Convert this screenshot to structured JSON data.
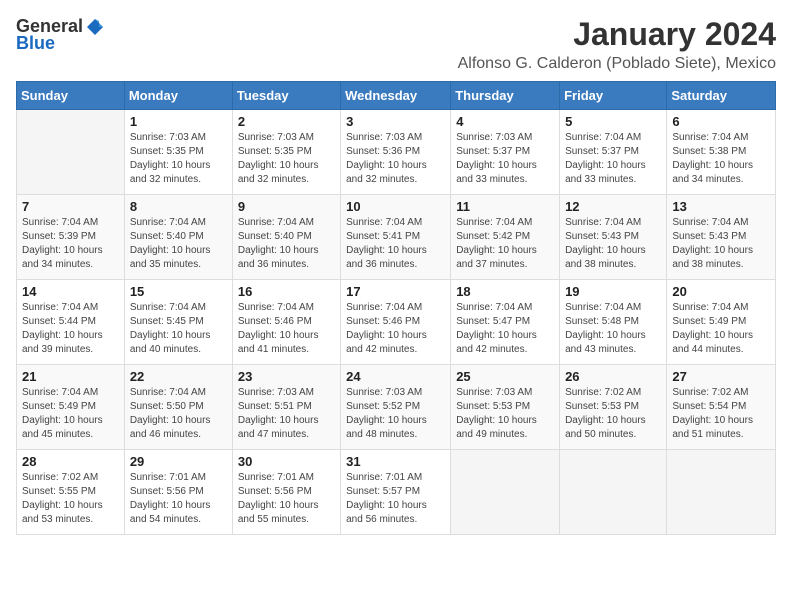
{
  "logo": {
    "general": "General",
    "blue": "Blue"
  },
  "title": "January 2024",
  "subtitle": "Alfonso G. Calderon (Poblado Siete), Mexico",
  "days_of_week": [
    "Sunday",
    "Monday",
    "Tuesday",
    "Wednesday",
    "Thursday",
    "Friday",
    "Saturday"
  ],
  "weeks": [
    [
      {
        "day": "",
        "info": ""
      },
      {
        "day": "1",
        "info": "Sunrise: 7:03 AM\nSunset: 5:35 PM\nDaylight: 10 hours\nand 32 minutes."
      },
      {
        "day": "2",
        "info": "Sunrise: 7:03 AM\nSunset: 5:35 PM\nDaylight: 10 hours\nand 32 minutes."
      },
      {
        "day": "3",
        "info": "Sunrise: 7:03 AM\nSunset: 5:36 PM\nDaylight: 10 hours\nand 32 minutes."
      },
      {
        "day": "4",
        "info": "Sunrise: 7:03 AM\nSunset: 5:37 PM\nDaylight: 10 hours\nand 33 minutes."
      },
      {
        "day": "5",
        "info": "Sunrise: 7:04 AM\nSunset: 5:37 PM\nDaylight: 10 hours\nand 33 minutes."
      },
      {
        "day": "6",
        "info": "Sunrise: 7:04 AM\nSunset: 5:38 PM\nDaylight: 10 hours\nand 34 minutes."
      }
    ],
    [
      {
        "day": "7",
        "info": "Sunrise: 7:04 AM\nSunset: 5:39 PM\nDaylight: 10 hours\nand 34 minutes."
      },
      {
        "day": "8",
        "info": "Sunrise: 7:04 AM\nSunset: 5:40 PM\nDaylight: 10 hours\nand 35 minutes."
      },
      {
        "day": "9",
        "info": "Sunrise: 7:04 AM\nSunset: 5:40 PM\nDaylight: 10 hours\nand 36 minutes."
      },
      {
        "day": "10",
        "info": "Sunrise: 7:04 AM\nSunset: 5:41 PM\nDaylight: 10 hours\nand 36 minutes."
      },
      {
        "day": "11",
        "info": "Sunrise: 7:04 AM\nSunset: 5:42 PM\nDaylight: 10 hours\nand 37 minutes."
      },
      {
        "day": "12",
        "info": "Sunrise: 7:04 AM\nSunset: 5:43 PM\nDaylight: 10 hours\nand 38 minutes."
      },
      {
        "day": "13",
        "info": "Sunrise: 7:04 AM\nSunset: 5:43 PM\nDaylight: 10 hours\nand 38 minutes."
      }
    ],
    [
      {
        "day": "14",
        "info": "Sunrise: 7:04 AM\nSunset: 5:44 PM\nDaylight: 10 hours\nand 39 minutes."
      },
      {
        "day": "15",
        "info": "Sunrise: 7:04 AM\nSunset: 5:45 PM\nDaylight: 10 hours\nand 40 minutes."
      },
      {
        "day": "16",
        "info": "Sunrise: 7:04 AM\nSunset: 5:46 PM\nDaylight: 10 hours\nand 41 minutes."
      },
      {
        "day": "17",
        "info": "Sunrise: 7:04 AM\nSunset: 5:46 PM\nDaylight: 10 hours\nand 42 minutes."
      },
      {
        "day": "18",
        "info": "Sunrise: 7:04 AM\nSunset: 5:47 PM\nDaylight: 10 hours\nand 42 minutes."
      },
      {
        "day": "19",
        "info": "Sunrise: 7:04 AM\nSunset: 5:48 PM\nDaylight: 10 hours\nand 43 minutes."
      },
      {
        "day": "20",
        "info": "Sunrise: 7:04 AM\nSunset: 5:49 PM\nDaylight: 10 hours\nand 44 minutes."
      }
    ],
    [
      {
        "day": "21",
        "info": "Sunrise: 7:04 AM\nSunset: 5:49 PM\nDaylight: 10 hours\nand 45 minutes."
      },
      {
        "day": "22",
        "info": "Sunrise: 7:04 AM\nSunset: 5:50 PM\nDaylight: 10 hours\nand 46 minutes."
      },
      {
        "day": "23",
        "info": "Sunrise: 7:03 AM\nSunset: 5:51 PM\nDaylight: 10 hours\nand 47 minutes."
      },
      {
        "day": "24",
        "info": "Sunrise: 7:03 AM\nSunset: 5:52 PM\nDaylight: 10 hours\nand 48 minutes."
      },
      {
        "day": "25",
        "info": "Sunrise: 7:03 AM\nSunset: 5:53 PM\nDaylight: 10 hours\nand 49 minutes."
      },
      {
        "day": "26",
        "info": "Sunrise: 7:02 AM\nSunset: 5:53 PM\nDaylight: 10 hours\nand 50 minutes."
      },
      {
        "day": "27",
        "info": "Sunrise: 7:02 AM\nSunset: 5:54 PM\nDaylight: 10 hours\nand 51 minutes."
      }
    ],
    [
      {
        "day": "28",
        "info": "Sunrise: 7:02 AM\nSunset: 5:55 PM\nDaylight: 10 hours\nand 53 minutes."
      },
      {
        "day": "29",
        "info": "Sunrise: 7:01 AM\nSunset: 5:56 PM\nDaylight: 10 hours\nand 54 minutes."
      },
      {
        "day": "30",
        "info": "Sunrise: 7:01 AM\nSunset: 5:56 PM\nDaylight: 10 hours\nand 55 minutes."
      },
      {
        "day": "31",
        "info": "Sunrise: 7:01 AM\nSunset: 5:57 PM\nDaylight: 10 hours\nand 56 minutes."
      },
      {
        "day": "",
        "info": ""
      },
      {
        "day": "",
        "info": ""
      },
      {
        "day": "",
        "info": ""
      }
    ]
  ]
}
